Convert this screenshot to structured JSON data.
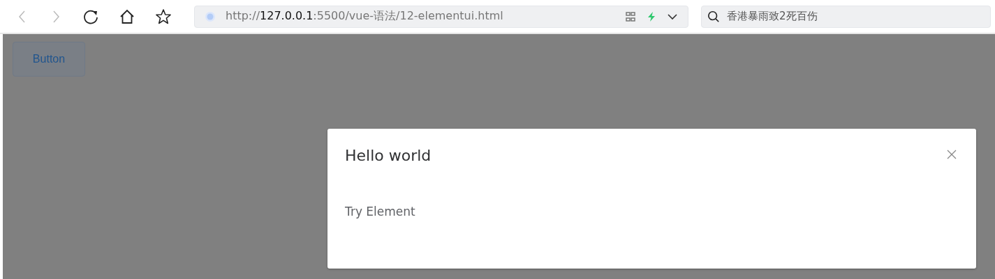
{
  "browser": {
    "address": {
      "scheme": "http://",
      "host": "127.0.0.1",
      "rest": ":5500/vue-语法/12-elementui.html"
    },
    "search": {
      "value": "香港暴雨致2死百伤"
    }
  },
  "page": {
    "button": "Button"
  },
  "dialog": {
    "title": "Hello world",
    "body": "Try Element"
  }
}
